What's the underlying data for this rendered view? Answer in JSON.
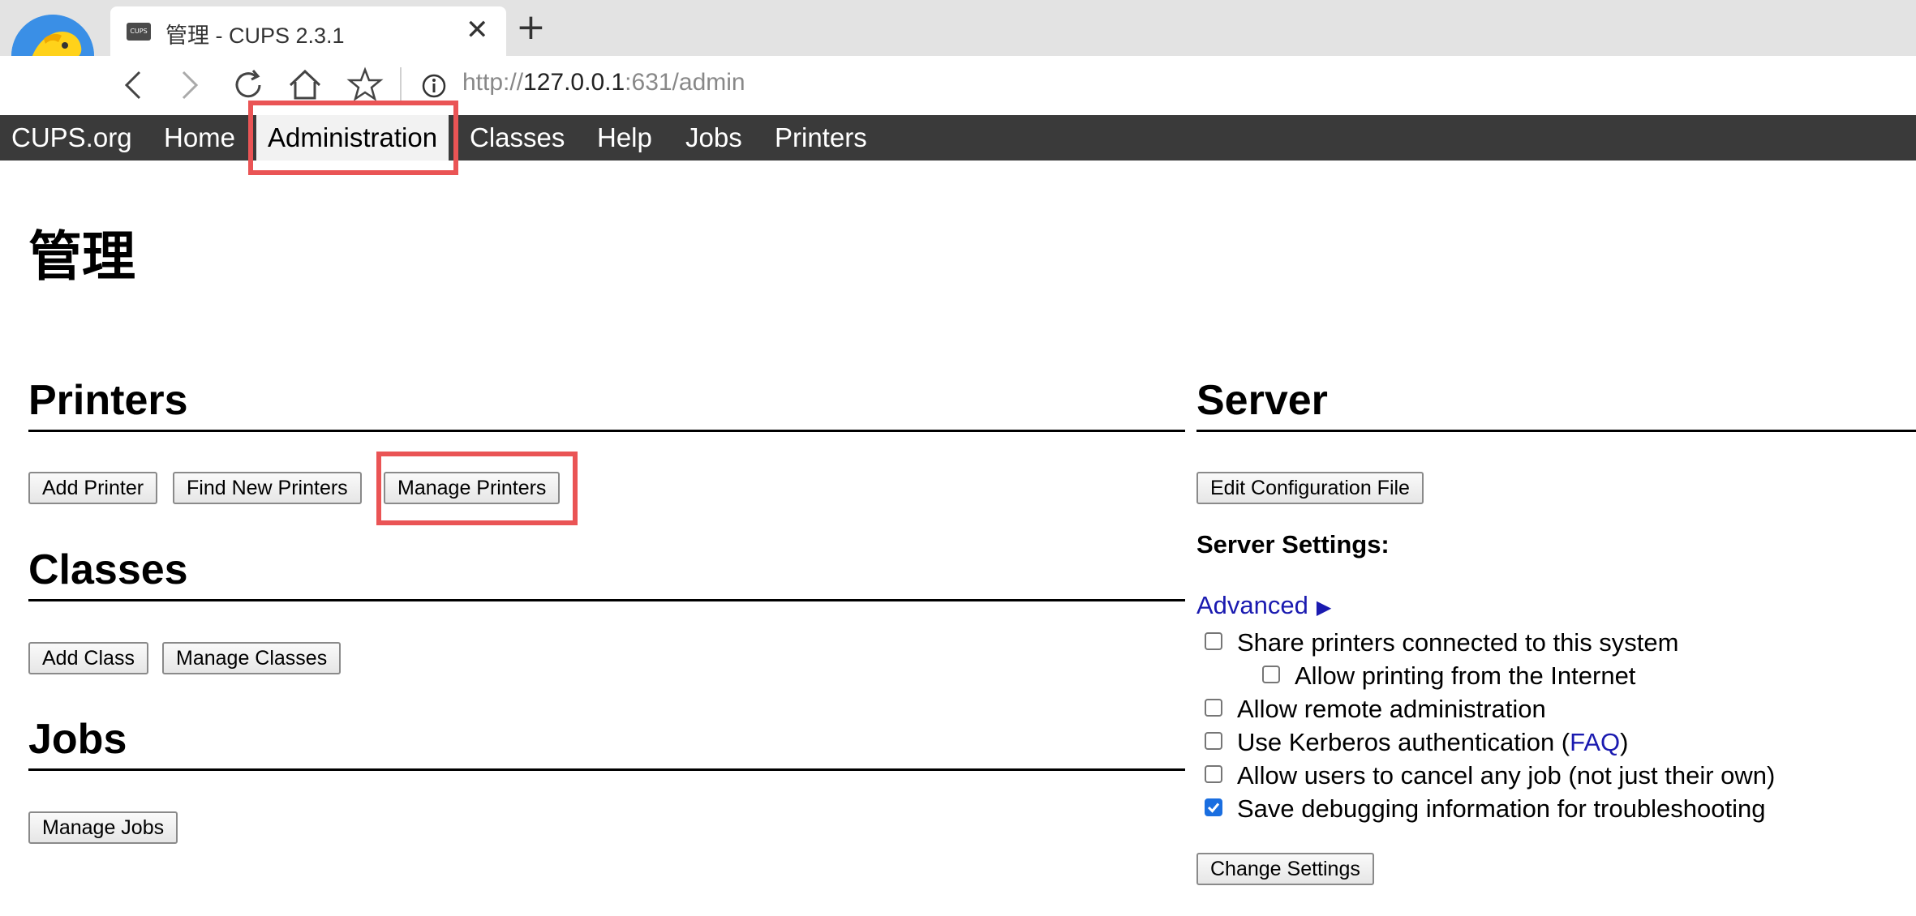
{
  "browser": {
    "tab_title": "管理 - CUPS 2.3.1",
    "tab_favicon_text": "CUPS",
    "close_glyph": "✕",
    "new_tab_glyph": "+",
    "url_scheme": "http://",
    "url_host": "127.0.0.1",
    "url_rest": ":631/admin"
  },
  "nav": {
    "items": [
      "CUPS.org",
      "Home",
      "Administration",
      "Classes",
      "Help",
      "Jobs",
      "Printers"
    ],
    "active": "Administration"
  },
  "page": {
    "title": "管理"
  },
  "printers": {
    "title": "Printers",
    "add_printer": "Add Printer",
    "find_new_printers": "Find New Printers",
    "manage_printers": "Manage Printers"
  },
  "classes": {
    "title": "Classes",
    "add_class": "Add Class",
    "manage_classes": "Manage Classes"
  },
  "jobs": {
    "title": "Jobs",
    "manage_jobs": "Manage Jobs"
  },
  "server": {
    "title": "Server",
    "edit_config": "Edit Configuration File",
    "settings_label": "Server Settings:",
    "advanced": "Advanced",
    "advanced_arrow": "▶",
    "options": [
      {
        "label": "Share printers connected to this system",
        "checked": false
      },
      {
        "label": "Allow printing from the Internet",
        "checked": false
      },
      {
        "label": "Allow remote administration",
        "checked": false
      },
      {
        "label_before": "Use Kerberos authentication (",
        "link": "FAQ",
        "label_after": ")",
        "checked": false
      },
      {
        "label": "Allow users to cancel any job (not just their own)",
        "checked": false
      },
      {
        "label": "Save debugging information for troubleshooting",
        "checked": true
      }
    ],
    "change_settings": "Change Settings"
  },
  "colors": {
    "nav_bar": "#3a3a3a",
    "highlight": "#ea5455",
    "link": "#1a1ab0",
    "checkbox_checked": "#1a6ee0"
  }
}
